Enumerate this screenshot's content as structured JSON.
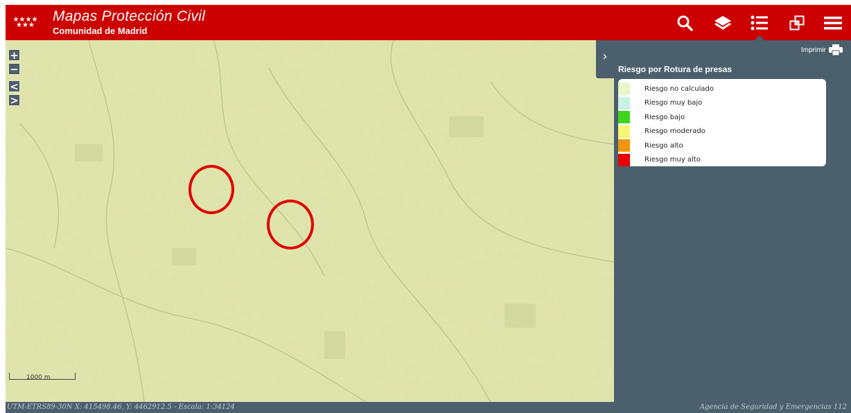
{
  "header": {
    "logo_stars": "★★★★\n★★★",
    "title": "Mapas Protección Civil",
    "subtitle": "Comunidad de Madrid",
    "background_color": "#cc0000",
    "buttons": [
      {
        "icon": "search-icon",
        "active": false
      },
      {
        "icon": "layers-icon",
        "active": false
      },
      {
        "icon": "legend-list-icon",
        "active": true
      },
      {
        "icon": "overview-map-icon",
        "active": false
      },
      {
        "icon": "menu-icon",
        "active": false
      }
    ]
  },
  "map": {
    "zoom_in": "+",
    "zoom_out": "−",
    "previous_extent": "<",
    "next_extent": ">",
    "scale_label": "1000 m",
    "background_color": "#dfe3aa"
  },
  "panel": {
    "collapse_label": "›",
    "print_label": "Imprimir",
    "legend_title": "Riesgo por Rotura de presas",
    "legend_items": [
      {
        "label": "Riesgo no calculado",
        "color": "#e6f7c8"
      },
      {
        "label": "Riesgo muy bajo",
        "color": "#c7f2e4"
      },
      {
        "label": "Riesgo bajo",
        "color": "#3fd41c"
      },
      {
        "label": "Riesgo moderado",
        "color": "#f5f571"
      },
      {
        "label": "Riesgo alto",
        "color": "#ef960a"
      },
      {
        "label": "Riesgo muy alto",
        "color": "#e80000"
      }
    ],
    "background_color": "#4b5f6d"
  },
  "status_bar": {
    "coordinates": "UTM-ETRS89-30N X: 415498.46, Y: 4462912.5 - Escala: 1:34124",
    "agency": "Agencia de Seguridad y Emergencias 112"
  }
}
